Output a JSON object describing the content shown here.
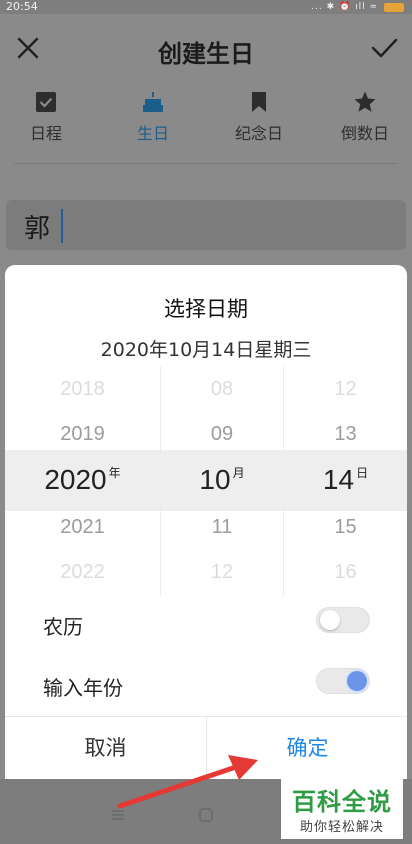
{
  "status_bar": {
    "time": "20:54",
    "icons": "... ✱ ⏰ ıll ≈"
  },
  "app_bar": {
    "title": "创建生日"
  },
  "tabs": [
    {
      "label": "日程",
      "icon": "checkbox-icon"
    },
    {
      "label": "生日",
      "icon": "cake-icon"
    },
    {
      "label": "纪念日",
      "icon": "bookmark-icon"
    },
    {
      "label": "倒数日",
      "icon": "star-icon"
    }
  ],
  "name_field": {
    "value": "郭"
  },
  "date_picker": {
    "title": "选择日期",
    "subtitle": "2020年10月14日星期三",
    "year": {
      "items": [
        "2018",
        "2019",
        "2020",
        "2021",
        "2022"
      ],
      "unit": "年"
    },
    "month": {
      "items": [
        "08",
        "09",
        "10",
        "11",
        "12"
      ],
      "unit": "月"
    },
    "day": {
      "items": [
        "12",
        "13",
        "14",
        "15",
        "16"
      ],
      "unit": "日"
    },
    "lunar": {
      "label": "农历",
      "enabled": false
    },
    "input_year": {
      "label": "输入年份",
      "enabled": true
    },
    "cancel_label": "取消",
    "ok_label": "确定"
  },
  "watermark": {
    "title": "百科全说",
    "subtitle": "助你轻松解决"
  },
  "colors": {
    "accent": "#1e88e5",
    "active_tab": "#1a5e8c",
    "toggle_on": "#6a95e8",
    "watermark": "#2f9b43",
    "arrow": "#e53935"
  }
}
